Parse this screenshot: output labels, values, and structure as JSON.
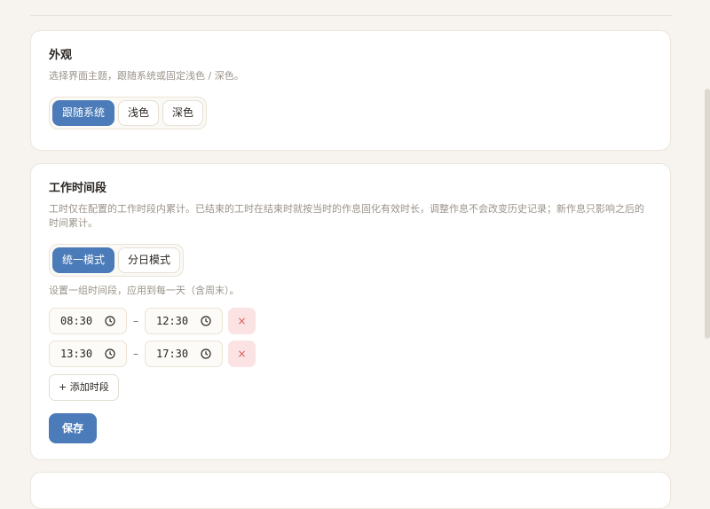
{
  "appearance": {
    "title": "外观",
    "desc": "选择界面主题，跟随系统或固定浅色 / 深色。",
    "options": [
      "跟随系统",
      "浅色",
      "深色"
    ],
    "selected": "跟随系统"
  },
  "worktime": {
    "title": "工作时间段",
    "desc": "工时仅在配置的工作时段内累计。已结束的工时在结束时就按当时的作息固化有效时长，调整作息不会改变历史记录；新作息只影响之后的时间累计。",
    "modes": [
      "统一模式",
      "分日模式"
    ],
    "selected_mode": "统一模式",
    "hint": "设置一组时间段，应用到每一天（含周末）。",
    "slots": [
      {
        "start": "08:30",
        "end": "12:30"
      },
      {
        "start": "13:30",
        "end": "17:30"
      }
    ],
    "range_sep": "–",
    "delete_glyph": "×",
    "add_label": "+ 添加时段",
    "save_label": "保存"
  },
  "colors": {
    "accent": "#4b7bb8",
    "danger_bg": "#fbe3e3",
    "danger": "#d55a5a"
  }
}
